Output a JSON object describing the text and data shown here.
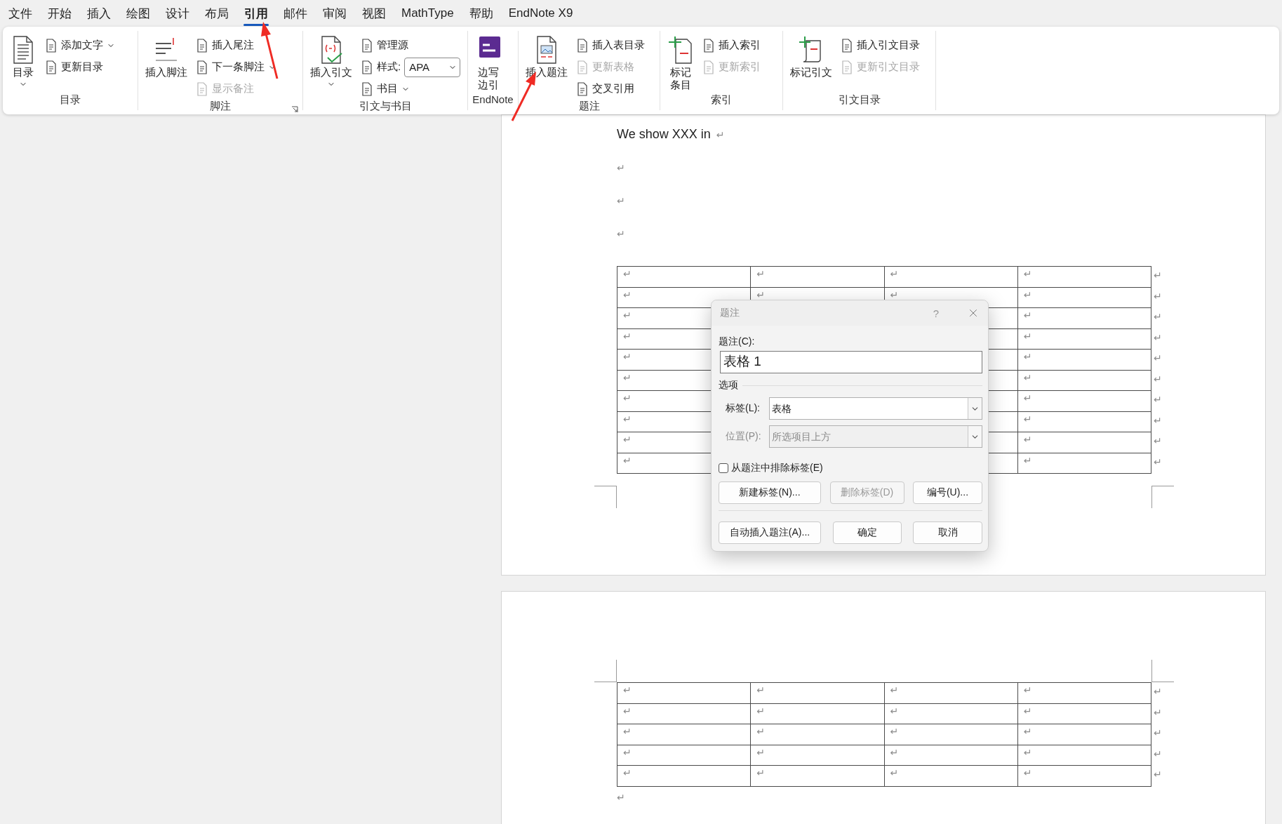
{
  "menu": {
    "tabs": [
      {
        "label": "文件",
        "selected": false
      },
      {
        "label": "开始",
        "selected": false
      },
      {
        "label": "插入",
        "selected": false
      },
      {
        "label": "绘图",
        "selected": false
      },
      {
        "label": "设计",
        "selected": false
      },
      {
        "label": "布局",
        "selected": false
      },
      {
        "label": "引用",
        "selected": true
      },
      {
        "label": "邮件",
        "selected": false
      },
      {
        "label": "审阅",
        "selected": false
      },
      {
        "label": "视图",
        "selected": false
      },
      {
        "label": "MathType",
        "selected": false
      },
      {
        "label": "帮助",
        "selected": false
      },
      {
        "label": "EndNote X9",
        "selected": false
      }
    ]
  },
  "ribbon": {
    "groups": [
      {
        "label": "目录",
        "large": [
          {
            "lines": [
              "目录"
            ],
            "dropdown": true
          }
        ],
        "small": [
          {
            "kind": "button",
            "label": "添加文字",
            "dropdown": true,
            "disabled": false
          },
          {
            "kind": "button",
            "label": "更新目录",
            "disabled": false
          }
        ]
      },
      {
        "label": "脚注",
        "launcher": true,
        "large": [
          {
            "lines": [
              "插入脚注"
            ]
          }
        ],
        "small": [
          {
            "kind": "button",
            "label": "插入尾注",
            "disabled": false
          },
          {
            "kind": "button",
            "label": "下一条脚注",
            "dropdown": true,
            "disabled": false
          },
          {
            "kind": "button",
            "label": "显示备注",
            "disabled": true
          }
        ]
      },
      {
        "label": "引文与书目",
        "large": [
          {
            "lines": [
              "插入引文"
            ],
            "dropdown": true
          }
        ],
        "small": [
          {
            "kind": "button",
            "label": "管理源",
            "disabled": false
          },
          {
            "kind": "select",
            "label": "样式:",
            "value": "APA"
          },
          {
            "kind": "button",
            "label": "书目",
            "dropdown": true,
            "disabled": false
          }
        ]
      },
      {
        "label": "EndNote",
        "large": [
          {
            "lines": [
              "边写",
              "边引"
            ]
          }
        ]
      },
      {
        "label": "题注",
        "large": [
          {
            "lines": [
              "插入题注"
            ]
          }
        ],
        "small": [
          {
            "kind": "button",
            "label": "插入表目录",
            "disabled": false
          },
          {
            "kind": "button",
            "label": "更新表格",
            "disabled": true
          },
          {
            "kind": "button",
            "label": "交叉引用",
            "disabled": false
          }
        ]
      },
      {
        "label": "索引",
        "large": [
          {
            "lines": [
              "标记",
              "条目"
            ]
          }
        ],
        "small": [
          {
            "kind": "button",
            "label": "插入索引",
            "disabled": false
          },
          {
            "kind": "button",
            "label": "更新索引",
            "disabled": true
          }
        ]
      },
      {
        "label": "引文目录",
        "large": [
          {
            "lines": [
              "标记引文"
            ]
          }
        ],
        "small": [
          {
            "kind": "button",
            "label": "插入引文目录",
            "disabled": false
          },
          {
            "kind": "button",
            "label": "更新引文目录",
            "disabled": true
          }
        ]
      }
    ]
  },
  "document": {
    "pages": [
      {
        "kind": "first",
        "before": [
          {
            "text": "We show XXX in",
            "mark": "↵"
          },
          {
            "mark": "↵"
          },
          {
            "mark": "↵"
          },
          {
            "mark": "↵"
          }
        ],
        "table": {
          "rows": [
            {
              "cells": [
                {
                  "mark": "↵"
                },
                {
                  "mark": "↵"
                },
                {
                  "mark": "↵"
                },
                {
                  "mark": "↵"
                }
              ],
              "end": "↵"
            },
            {
              "cells": [
                {
                  "mark": "↵"
                },
                {
                  "mark": "↵"
                },
                {
                  "mark": "↵"
                },
                {
                  "mark": "↵"
                }
              ],
              "end": "↵"
            },
            {
              "cells": [
                {
                  "mark": "↵"
                },
                {},
                {},
                {
                  "mark": "↵"
                }
              ],
              "end": "↵"
            },
            {
              "cells": [
                {
                  "mark": "↵"
                },
                {},
                {},
                {
                  "mark": "↵"
                }
              ],
              "end": "↵"
            },
            {
              "cells": [
                {
                  "mark": "↵"
                },
                {},
                {},
                {
                  "mark": "↵"
                }
              ],
              "end": "↵"
            },
            {
              "cells": [
                {
                  "mark": "↵"
                },
                {},
                {},
                {
                  "mark": "↵"
                }
              ],
              "end": "↵"
            },
            {
              "cells": [
                {
                  "mark": "↵"
                },
                {},
                {},
                {
                  "mark": "↵"
                }
              ],
              "end": "↵"
            },
            {
              "cells": [
                {
                  "mark": "↵"
                },
                {},
                {},
                {
                  "mark": "↵"
                }
              ],
              "end": "↵"
            },
            {
              "cells": [
                {
                  "mark": "↵"
                },
                {},
                {},
                {
                  "mark": "↵"
                }
              ],
              "end": "↵"
            },
            {
              "cells": [
                {
                  "mark": "↵"
                },
                {},
                {},
                {
                  "mark": "↵"
                }
              ],
              "end": "↵"
            }
          ]
        }
      },
      {
        "kind": "continued",
        "table": {
          "rows": [
            {
              "cells": [
                {
                  "mark": "↵"
                },
                {
                  "mark": "↵"
                },
                {
                  "mark": "↵"
                },
                {
                  "mark": "↵"
                }
              ],
              "end": "↵"
            },
            {
              "cells": [
                {
                  "mark": "↵"
                },
                {
                  "mark": "↵"
                },
                {
                  "mark": "↵"
                },
                {
                  "mark": "↵"
                }
              ],
              "end": "↵"
            },
            {
              "cells": [
                {
                  "mark": "↵"
                },
                {
                  "mark": "↵"
                },
                {
                  "mark": "↵"
                },
                {
                  "mark": "↵"
                }
              ],
              "end": "↵"
            },
            {
              "cells": [
                {
                  "mark": "↵"
                },
                {
                  "mark": "↵"
                },
                {
                  "mark": "↵"
                },
                {
                  "mark": "↵"
                }
              ],
              "end": "↵"
            },
            {
              "cells": [
                {
                  "mark": "↵"
                },
                {
                  "mark": "↵"
                },
                {
                  "mark": "↵"
                },
                {
                  "mark": "↵"
                }
              ],
              "end": "↵"
            }
          ]
        },
        "after": [
          {
            "mark": "↵"
          }
        ]
      }
    ]
  },
  "dialog": {
    "title": "题注",
    "help": "?",
    "caption": {
      "label": "题注(C):",
      "value": "表格 1"
    },
    "options_heading": "选项",
    "fields": [
      {
        "label": "标签(L):",
        "value": "表格",
        "disabled": false
      },
      {
        "label": "位置(P):",
        "value": "所选项目上方",
        "disabled": true
      }
    ],
    "checkbox": {
      "label": "从题注中排除标签(E)",
      "checked": false
    },
    "buttons": [
      {
        "label": "新建标签(N)...",
        "disabled": false
      },
      {
        "label": "删除标签(D)",
        "disabled": true
      },
      {
        "label": "编号(U)...",
        "disabled": false
      }
    ],
    "footer_buttons": [
      {
        "label": "自动插入题注(A)...",
        "disabled": false
      },
      {
        "label": "确定",
        "disabled": false
      },
      {
        "label": "取消",
        "disabled": false
      }
    ]
  }
}
